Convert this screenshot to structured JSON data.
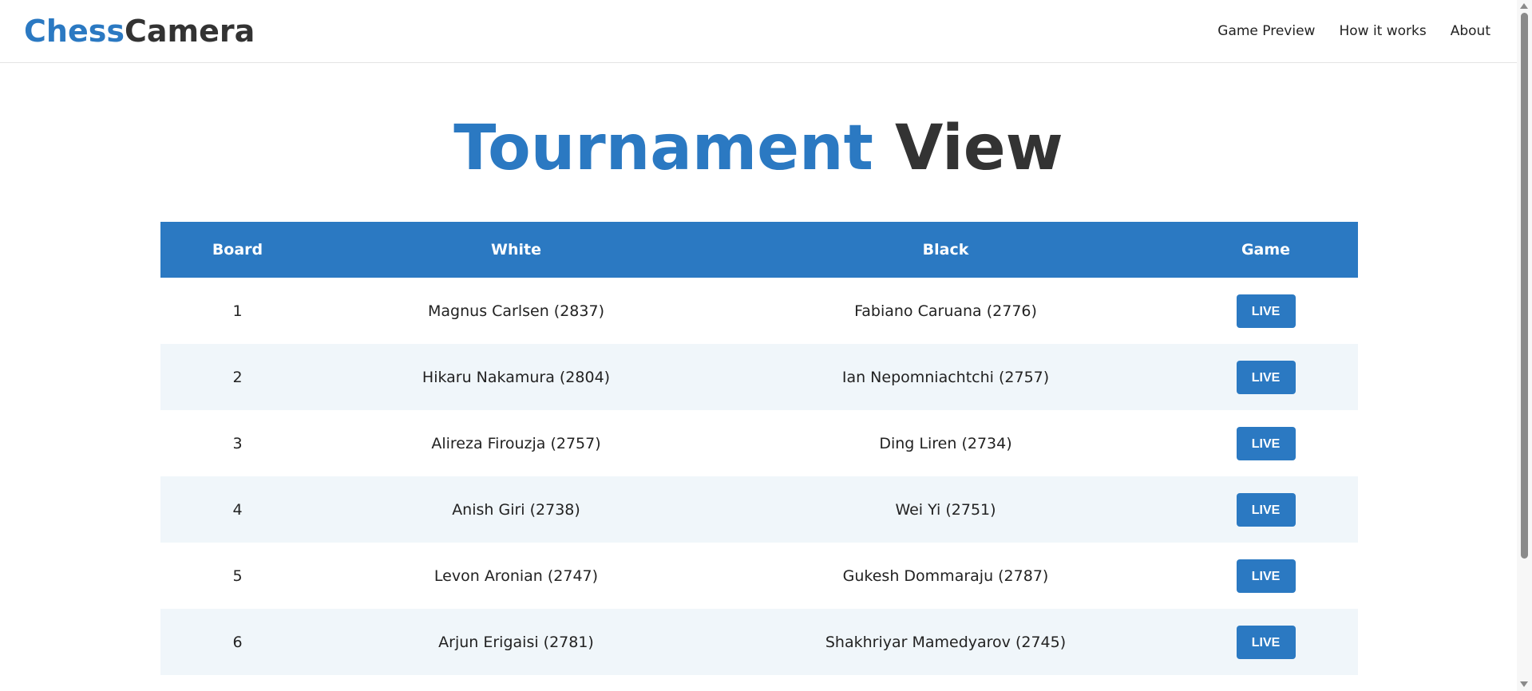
{
  "header": {
    "logo_part1": "Chess",
    "logo_part2": "Camera",
    "nav": [
      "Game Preview",
      "How it works",
      "About"
    ]
  },
  "title": {
    "part1": "Tournament",
    "part2": "View"
  },
  "table": {
    "columns": [
      "Board",
      "White",
      "Black",
      "Game"
    ],
    "rows": [
      {
        "board": "1",
        "white": "Magnus Carlsen (2837)",
        "black": "Fabiano Caruana (2776)",
        "game": "LIVE"
      },
      {
        "board": "2",
        "white": "Hikaru Nakamura (2804)",
        "black": "Ian Nepomniachtchi (2757)",
        "game": "LIVE"
      },
      {
        "board": "3",
        "white": "Alireza Firouzja (2757)",
        "black": "Ding Liren (2734)",
        "game": "LIVE"
      },
      {
        "board": "4",
        "white": "Anish Giri (2738)",
        "black": "Wei Yi (2751)",
        "game": "LIVE"
      },
      {
        "board": "5",
        "white": "Levon Aronian (2747)",
        "black": "Gukesh Dommaraju (2787)",
        "game": "LIVE"
      },
      {
        "board": "6",
        "white": "Arjun Erigaisi (2781)",
        "black": "Shakhriyar Mamedyarov (2745)",
        "game": "LIVE"
      }
    ]
  },
  "colors": {
    "accent": "#2b79c2",
    "dark_text": "#333333",
    "row_alt": "#f0f6fa"
  }
}
